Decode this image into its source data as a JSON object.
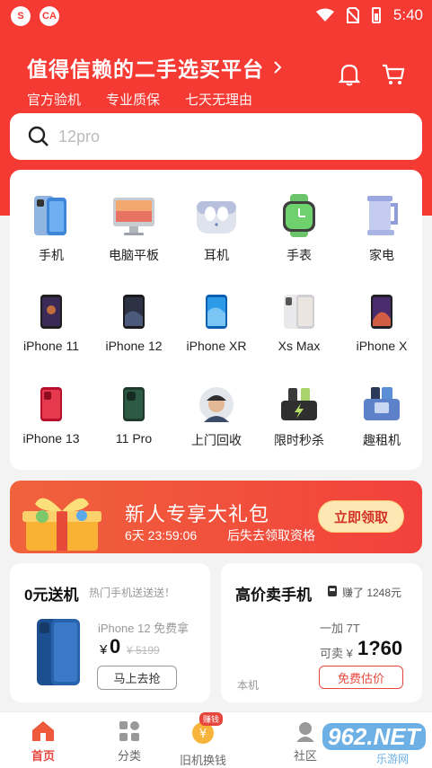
{
  "status": {
    "time": "5:40"
  },
  "header": {
    "title": "值得信赖的二手选买平台",
    "subs": [
      "官方验机",
      "专业质保",
      "七天无理由"
    ]
  },
  "search": {
    "placeholder": "12pro"
  },
  "categories": [
    {
      "label": "手机",
      "icon": "phone-icon"
    },
    {
      "label": "电脑平板",
      "icon": "computer-icon"
    },
    {
      "label": "耳机",
      "icon": "earbuds-icon"
    },
    {
      "label": "手表",
      "icon": "watch-icon"
    },
    {
      "label": "家电",
      "icon": "kettle-icon"
    },
    {
      "label": "iPhone 11",
      "icon": "iphone-11-icon"
    },
    {
      "label": "iPhone 12",
      "icon": "iphone-12-icon"
    },
    {
      "label": "iPhone XR",
      "icon": "iphone-xr-icon"
    },
    {
      "label": "Xs Max",
      "icon": "xs-max-icon"
    },
    {
      "label": "iPhone X",
      "icon": "iphone-x-icon"
    },
    {
      "label": "iPhone 13",
      "icon": "iphone-13-icon"
    },
    {
      "label": "11 Pro",
      "icon": "11-pro-icon"
    },
    {
      "label": "上门回收",
      "icon": "recycle-agent-icon"
    },
    {
      "label": "限时秒杀",
      "icon": "flash-sale-icon"
    },
    {
      "label": "趣租机",
      "icon": "rent-phone-icon"
    }
  ],
  "banner": {
    "title": "新人专享大礼包",
    "countdown": "6天 23:59:06",
    "note": "后失去领取资格",
    "button": "立即领取"
  },
  "card_free": {
    "title": "0元送机",
    "subtitle": "热门手机送送送！",
    "product": "iPhone 12 免费拿",
    "currency": "¥",
    "price": "0",
    "original": "¥ 5199",
    "button": "马上去抢"
  },
  "card_sell": {
    "title": "高价卖手机",
    "earned": "赚了 1248元",
    "model": "一加 7T",
    "sell_label": "可卖 ¥",
    "sell_price": "1?60",
    "button": "免费估价",
    "note": "本机"
  },
  "nav": [
    {
      "label": "首页",
      "icon": "home-icon"
    },
    {
      "label": "分类",
      "icon": "category-icon"
    },
    {
      "label": "旧机换钱",
      "icon": "trade-in-icon",
      "badge": "赚钱"
    },
    {
      "label": "社区",
      "icon": "community-icon"
    }
  ],
  "watermark": {
    "text": "962.NET",
    "sub": "乐游网"
  },
  "colors": {
    "brand": "#f53a34",
    "accent": "#d3302a"
  }
}
